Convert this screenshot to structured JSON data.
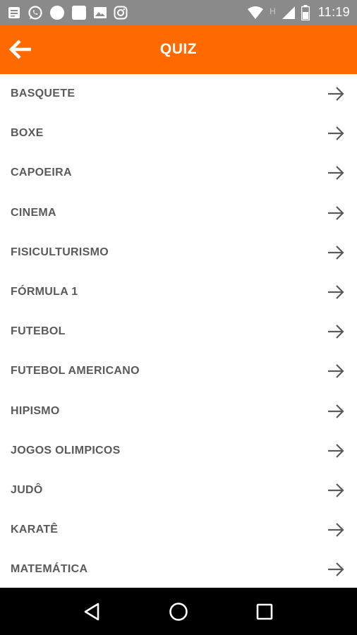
{
  "status_bar": {
    "time": "11:19",
    "icons_left": [
      "notification-icon",
      "whatsapp-icon",
      "circle-icon",
      "square-app-icon",
      "image-icon",
      "instagram-icon"
    ],
    "icons_right": [
      "wifi-icon",
      "network-h-icon",
      "signal-icon",
      "battery-icon"
    ],
    "network_label": "H"
  },
  "app_bar": {
    "title": "QUIZ",
    "background": "#ff6a00",
    "back_icon": "arrow-left-icon"
  },
  "list": {
    "items": [
      {
        "label": "BASQUETE"
      },
      {
        "label": "BOXE"
      },
      {
        "label": "CAPOEIRA"
      },
      {
        "label": "CINEMA"
      },
      {
        "label": "FISICULTURISMO"
      },
      {
        "label": "FÓRMULA 1"
      },
      {
        "label": "FUTEBOL"
      },
      {
        "label": "FUTEBOL AMERICANO"
      },
      {
        "label": "HIPISMO"
      },
      {
        "label": "JOGOS OLIMPICOS"
      },
      {
        "label": "JUDÔ"
      },
      {
        "label": "KARATÊ"
      },
      {
        "label": "MATEMÁTICA"
      }
    ],
    "item_icon": "arrow-right-icon"
  },
  "nav_bar": {
    "buttons": [
      "back-triangle-icon",
      "home-circle-icon",
      "recents-square-icon"
    ]
  }
}
